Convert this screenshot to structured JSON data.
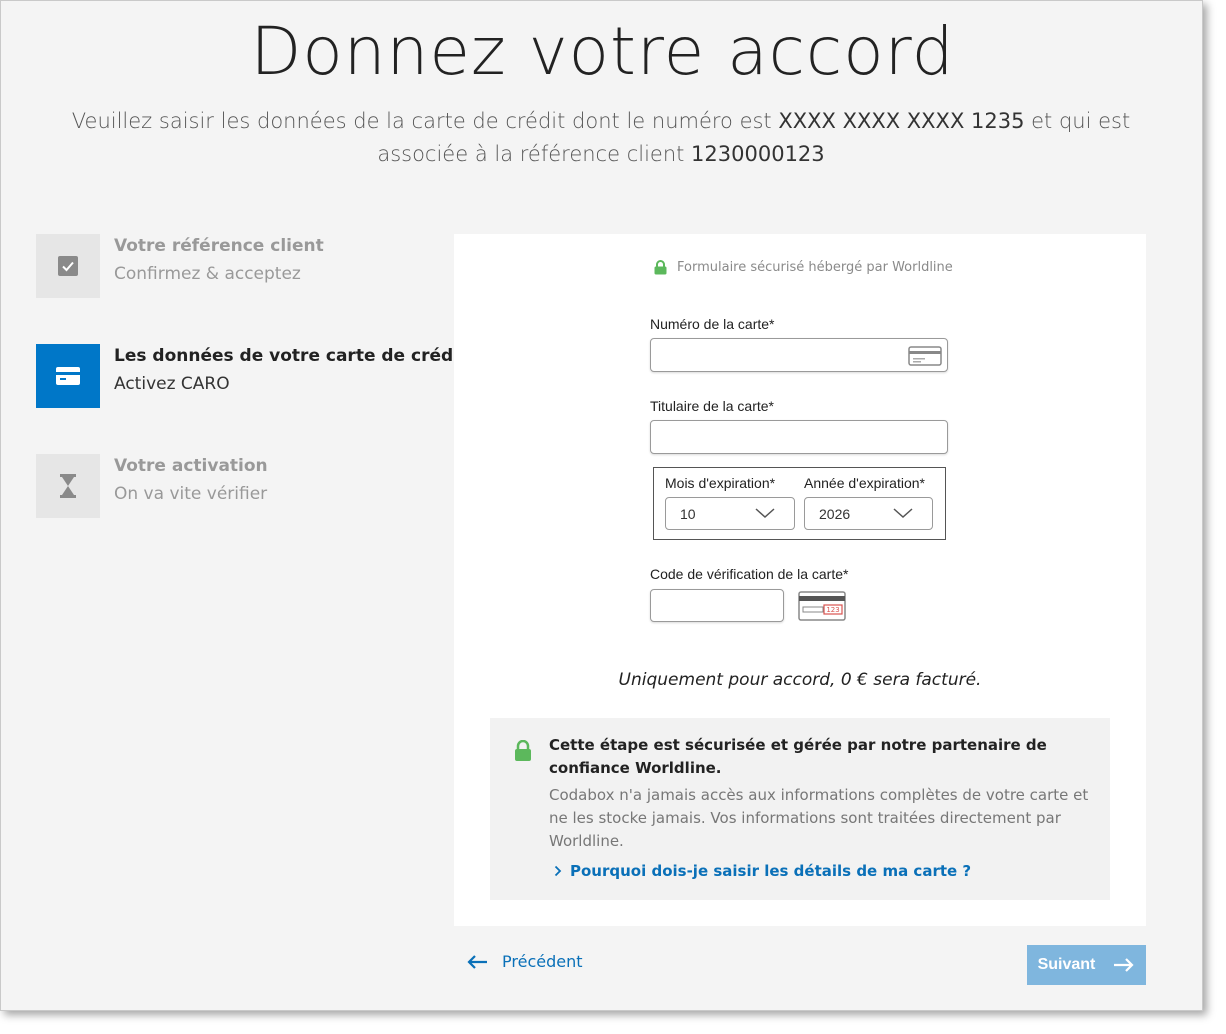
{
  "header": {
    "title": "Donnez votre accord",
    "subtitle_part1": "Veuillez saisir les données de la carte de crédit dont le numéro est ",
    "card_number_masked": "XXXX XXXX XXXX 1235",
    "subtitle_part2": " et qui est associée à la référence client ",
    "client_reference": "1230000123"
  },
  "steps": [
    {
      "title": "Votre référence client",
      "subtitle": "Confirmez & acceptez",
      "state": "done",
      "icon": "check-icon"
    },
    {
      "title": "Les données de votre carte de crédit",
      "subtitle": "Activez CARO",
      "state": "active",
      "icon": "credit-card-icon"
    },
    {
      "title": "Votre activation",
      "subtitle": "On va vite vérifier",
      "state": "pending",
      "icon": "hourglass-icon"
    }
  ],
  "form": {
    "secure_text": "Formulaire sécurisé hébergé par Worldline",
    "card_number_label": "Numéro de la carte*",
    "card_number_value": "",
    "holder_label": "Titulaire de la carte*",
    "holder_value": "",
    "exp_month_label": "Mois d'expiration*",
    "exp_month_value": "10",
    "exp_year_label": "Année d'expiration*",
    "exp_year_value": "2026",
    "cvc_label": "Code de vérification de la carte*",
    "cvc_value": "",
    "cvc_hint_digits": "123"
  },
  "note": "Uniquement pour accord, 0 € sera facturé.",
  "info": {
    "heading": "Cette étape est sécurisée et gérée par notre partenaire de confiance Worldline.",
    "body": "Codabox n'a jamais accès aux informations complètes de votre carte et ne les stocke jamais. Vos informations sont traitées directement par Worldline.",
    "link": "Pourquoi dois-je saisir les détails de ma carte ?"
  },
  "nav": {
    "prev_label": "Précédent",
    "next_label": "Suivant"
  },
  "colors": {
    "accent": "#0077c8",
    "link": "#0a70b8",
    "next_button": "#7fb6de",
    "lock_green": "#5cb85c"
  }
}
